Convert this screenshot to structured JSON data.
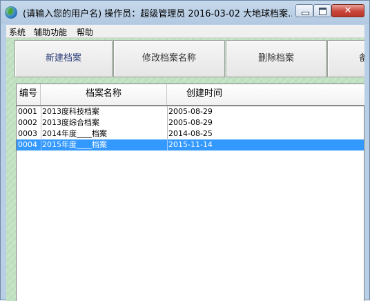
{
  "window": {
    "title": "(请输入您的用户名)   操作员：超级管理员   2016-03-02   大地球档案..."
  },
  "menu": {
    "items": [
      "系统",
      "辅助功能",
      "帮助"
    ]
  },
  "toolbar": {
    "new_label": "新建档案",
    "rename_label": "修改档案名称",
    "delete_label": "删除档案",
    "backup_label": "备"
  },
  "table": {
    "columns": [
      "编号",
      "档案名称",
      "创建时间"
    ],
    "rows": [
      {
        "id": "0001",
        "name": "2013度科技档案",
        "created": "2005-08-29"
      },
      {
        "id": "0002",
        "name": "2013度综合档案",
        "created": "2005-08-29"
      },
      {
        "id": "0003",
        "name": "2014年度____档案",
        "created": "2014-08-25"
      },
      {
        "id": "0004",
        "name": "2015年度____档案",
        "created": "2015-11-14"
      }
    ],
    "selected_index": 3
  },
  "icons": {
    "app": "globe-icon",
    "minimize": "minimize-icon",
    "maximize": "maximize-icon",
    "close": "close-icon"
  },
  "colors": {
    "selection": "#3399ff",
    "client_background": "#bfe0c1",
    "title_bar": "#b9cfe6"
  }
}
